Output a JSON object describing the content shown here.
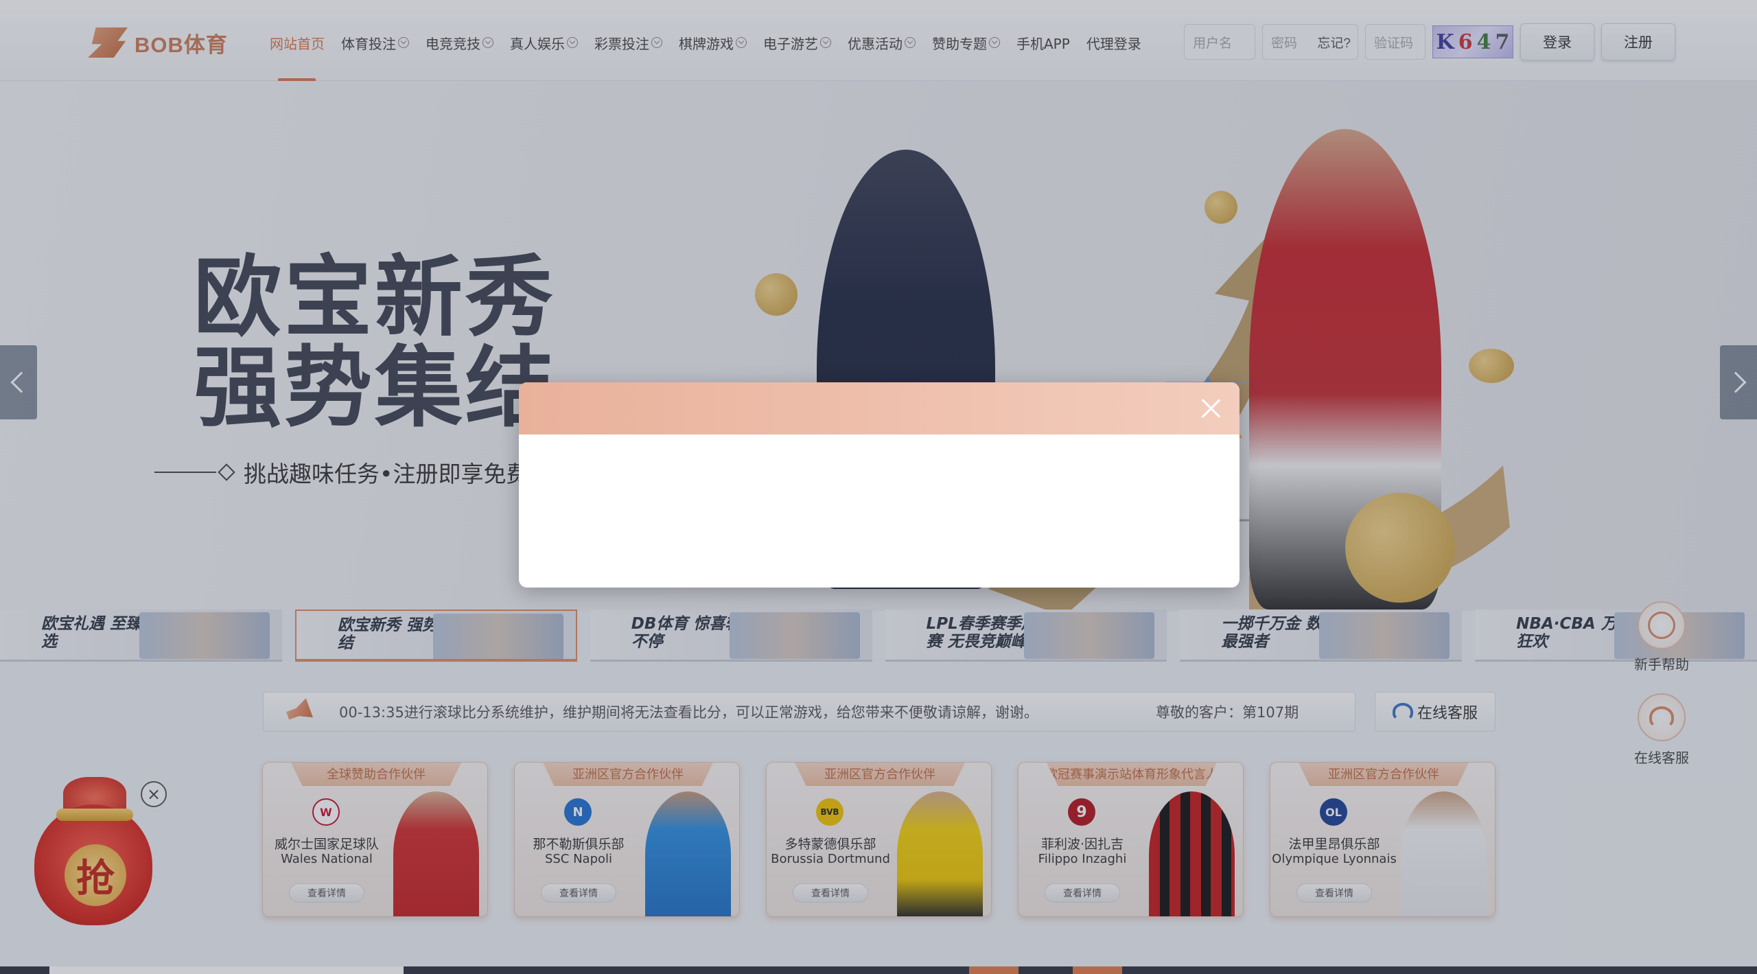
{
  "header": {
    "logo_text": "BOB体育",
    "nav": [
      {
        "label": "网站首页",
        "dropdown": false,
        "active": true
      },
      {
        "label": "体育投注",
        "dropdown": true
      },
      {
        "label": "电竞竞技",
        "dropdown": true
      },
      {
        "label": "真人娱乐",
        "dropdown": true
      },
      {
        "label": "彩票投注",
        "dropdown": true
      },
      {
        "label": "棋牌游戏",
        "dropdown": true
      },
      {
        "label": "电子游艺",
        "dropdown": true
      },
      {
        "label": "优惠活动",
        "dropdown": true
      },
      {
        "label": "赞助专题",
        "dropdown": true
      },
      {
        "label": "手机APP",
        "dropdown": false
      },
      {
        "label": "代理登录",
        "dropdown": false
      }
    ],
    "login": {
      "username_placeholder": "用户名",
      "password_placeholder": "密码",
      "forgot_label": "忘记?",
      "captcha_placeholder": "验证码",
      "captcha_chars": [
        "K",
        "6",
        "4",
        "7"
      ],
      "login_label": "登录",
      "register_label": "注册"
    }
  },
  "banner": {
    "title_line1": "欧宝新秀",
    "title_line2": "强势集结",
    "subtitle": "挑战趣味任务•注册即享免费"
  },
  "thumbnails": [
    {
      "text": "欧宝礼遇 至臻精选"
    },
    {
      "text": "欧宝新秀 强势集结",
      "selected": true
    },
    {
      "text": "DB体育 惊喜转不停"
    },
    {
      "text": "LPL春季赛季后赛 无畏竞巅峰"
    },
    {
      "text": "一掷千万金 数富最强者"
    },
    {
      "text": "NBA·CBA 万投狂欢"
    }
  ],
  "notice": {
    "text": "00-13:35进行滚球比分系统维护，维护期间将无法查看比分，可以正常游戏，给您带来不便敬请谅解，谢谢。",
    "right_text": "尊敬的客户：第107期",
    "cs_label": "在线客服"
  },
  "sponsors": [
    {
      "tag": "全球赞助合作伙伴",
      "cn": "威尔士国家足球队",
      "en": "Wales National",
      "btn": "查看详情",
      "emblem": "W",
      "emblem_color": "#c8102e"
    },
    {
      "tag": "亚洲区官方合作伙伴",
      "cn": "那不勒斯俱乐部",
      "en": "SSC Napoli",
      "btn": "查看详情",
      "emblem": "N",
      "emblem_color": "#1f6fd0"
    },
    {
      "tag": "亚洲区官方合作伙伴",
      "cn": "多特蒙德俱乐部",
      "en": "Borussia Dortmund",
      "btn": "查看详情",
      "emblem": "BVB",
      "emblem_color": "#f2c400"
    },
    {
      "tag": "欧冠赛事演示站体育形象代言人",
      "cn": "菲利波·因扎吉",
      "en": "Filippo Inzaghi",
      "btn": "查看详情",
      "emblem": "9",
      "emblem_color": "#b3121c"
    },
    {
      "tag": "亚洲区官方合作伙伴",
      "cn": "法甲里昂俱乐部",
      "en": "Olympique Lyonnais",
      "btn": "查看详情",
      "emblem": "OL",
      "emblem_color": "#1b3f95"
    }
  ],
  "float": {
    "help_label": "新手帮助",
    "cs_label": "在线客服"
  },
  "red_bag": {
    "char": "抢",
    "close": "×"
  },
  "modal": {
    "visible": true
  }
}
